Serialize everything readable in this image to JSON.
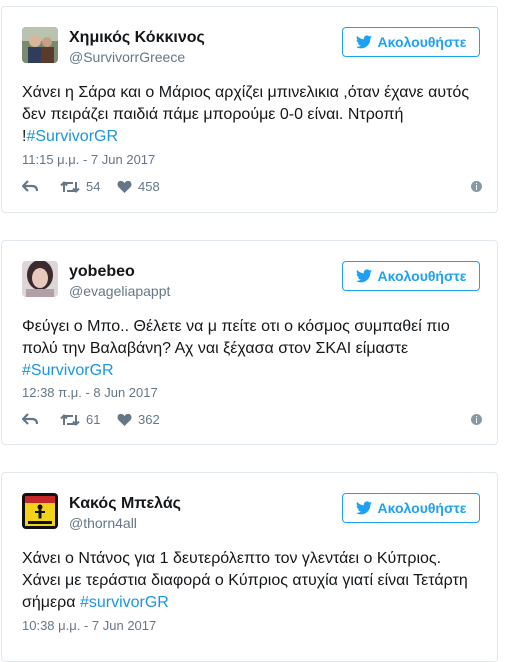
{
  "colors": {
    "accent": "#1da1f2",
    "hashtag": "#1b95e0",
    "secondary_text": "#657786",
    "border": "#e1e8ed"
  },
  "tweets": [
    {
      "name": "Χημικός Κόκκινος",
      "handle": "@SurvivorrGreece",
      "follow_label": "Ακολουθήστε",
      "text": "Χάνει η Σάρα και ο Μάριος αρχίζει μπινελικια ,όταν έχανε αυτός δεν πειράζει παιδιά πάμε μπορούμε 0-0 είναι. Ντροπή !",
      "hashtag": "#SurvivorGR",
      "timestamp": "11:15 μ.μ. - 7 Jun 2017",
      "retweets": "54",
      "likes": "458",
      "avatar_icon": "user-photo-avatar"
    },
    {
      "name": "yobebeo",
      "handle": "@evageliapappt",
      "follow_label": "Ακολουθήστε",
      "text": "Φεύγει ο Μπο.. Θέλετε να μ πείτε οτι ο κόσμος συμπαθεί πιο πολύ την Βαλαβάνη? Αχ ναι ξέχασα στον ΣΚΑΙ είμαστε",
      "hashtag": "#SurvivorGR",
      "timestamp": "12:38 π.μ. - 8 Jun 2017",
      "retweets": "61",
      "likes": "362",
      "avatar_icon": "user-photo-avatar"
    },
    {
      "name": "Κακός Μπελάς",
      "handle": "@thorn4all",
      "follow_label": "Ακολουθήστε",
      "text": "Χάνει ο Ντάνος για 1 δευτερόλεπτο τον γλεντάει ο Κύπριος. Χάνει με τεράστια διαφορά ο Κύπριος ατυχία γιατί είναι Τετάρτη σήμερα",
      "hashtag": "#survivorGR",
      "timestamp": "10:38 μ.μ. - 7 Jun 2017",
      "avatar_icon": "warning-sign-avatar"
    }
  ]
}
